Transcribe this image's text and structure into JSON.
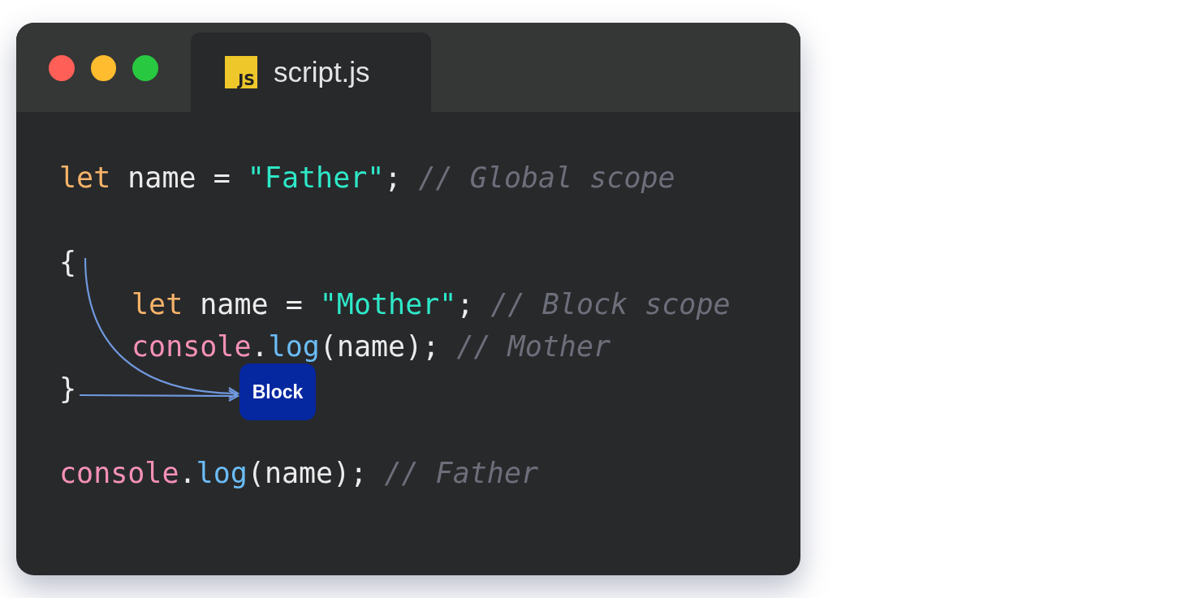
{
  "window": {
    "controls": [
      {
        "color": "#ff5f57"
      },
      {
        "color": "#febc2e"
      },
      {
        "color": "#28c840"
      }
    ]
  },
  "tab": {
    "icon_text": "JS",
    "label": "script.js",
    "selected": true
  },
  "code": {
    "sections": [
      {
        "lines": [
          {
            "tokens": [
              {
                "kind": "keyword",
                "text": "let"
              },
              {
                "kind": "plain",
                "text": " name = "
              },
              {
                "kind": "string",
                "text": "\"Father\""
              },
              {
                "kind": "plain",
                "text": "; "
              },
              {
                "kind": "comment",
                "text": "// Global scope"
              }
            ]
          }
        ]
      },
      {
        "lines": [
          {
            "tokens": [
              {
                "kind": "plain",
                "text": "{"
              }
            ],
            "children": [
              {
                "tokens": [
                  {
                    "kind": "keyword",
                    "text": "let"
                  },
                  {
                    "kind": "plain",
                    "text": " name = "
                  },
                  {
                    "kind": "string",
                    "text": "\"Mother\""
                  },
                  {
                    "kind": "plain",
                    "text": "; "
                  },
                  {
                    "kind": "comment",
                    "text": "// Block scope"
                  }
                ]
              },
              {
                "tokens": [
                  {
                    "kind": "object",
                    "text": "console"
                  },
                  {
                    "kind": "plain",
                    "text": "."
                  },
                  {
                    "kind": "method",
                    "text": "log"
                  },
                  {
                    "kind": "plain",
                    "text": "(name); "
                  },
                  {
                    "kind": "comment",
                    "text": "// Mother"
                  }
                ]
              }
            ]
          },
          {
            "tokens": [
              {
                "kind": "plain",
                "text": "}"
              }
            ]
          }
        ]
      },
      {
        "lines": [
          {
            "tokens": [
              {
                "kind": "object",
                "text": "console"
              },
              {
                "kind": "plain",
                "text": "."
              },
              {
                "kind": "method",
                "text": "log"
              },
              {
                "kind": "plain",
                "text": "(name); "
              },
              {
                "kind": "comment",
                "text": "// Father"
              }
            ]
          }
        ]
      }
    ]
  },
  "annotation": {
    "label": "Block"
  }
}
